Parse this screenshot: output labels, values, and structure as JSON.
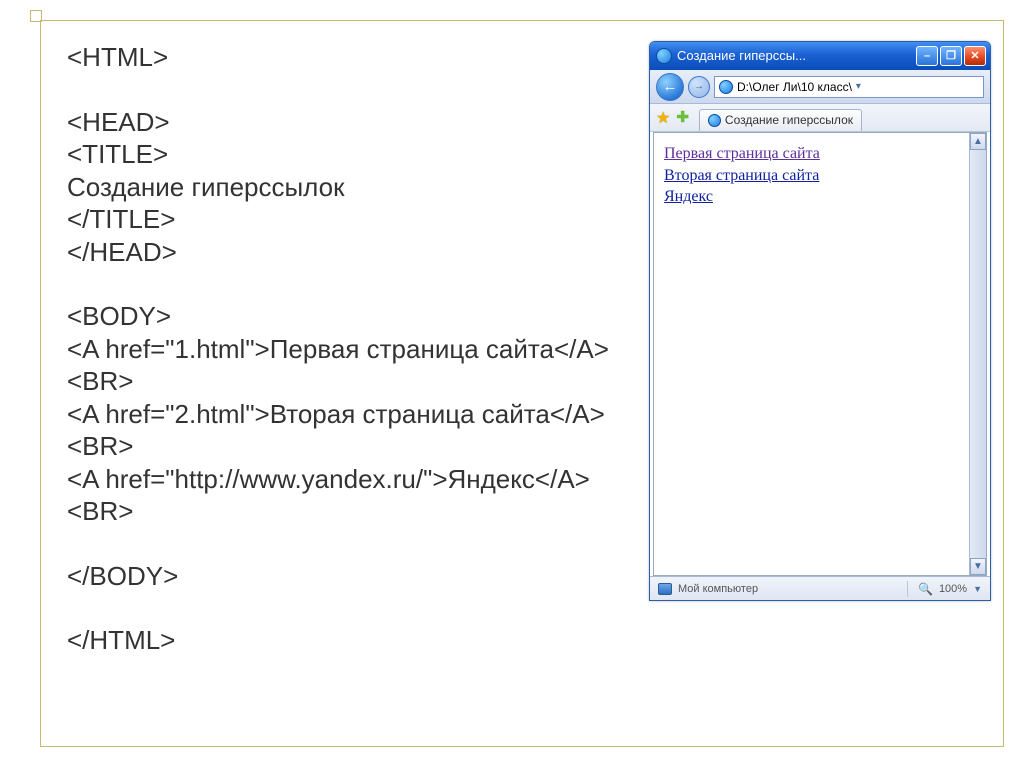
{
  "code": {
    "l1": "<HTML>",
    "l2": "<HEAD>",
    "l3": "<TITLE>",
    "l4": "Создание гиперссылок",
    "l5": "</TITLE>",
    "l6": "</HEAD>",
    "l7": "<BODY>",
    "l8": "<A href=\"1.html\">Первая страница сайта</A><BR>",
    "l9": "<A href=\"2.html\">Вторая страница сайта</A><BR>",
    "l10": "<A href=\"http://www.yandex.ru/\">Яндекс</A><BR>",
    "l11": "</BODY>",
    "l12": "</HTML>"
  },
  "browser": {
    "window_title": "Создание гиперссы...",
    "address": "D:\\Олег Ли\\10 класс\\",
    "tab_label": "Создание гиперссылок",
    "links": {
      "link1": "Первая страница сайта",
      "link2": "Вторая страница сайта",
      "link3": "Яндекс"
    },
    "status_left": "Мой компьютер",
    "zoom": "100%"
  }
}
